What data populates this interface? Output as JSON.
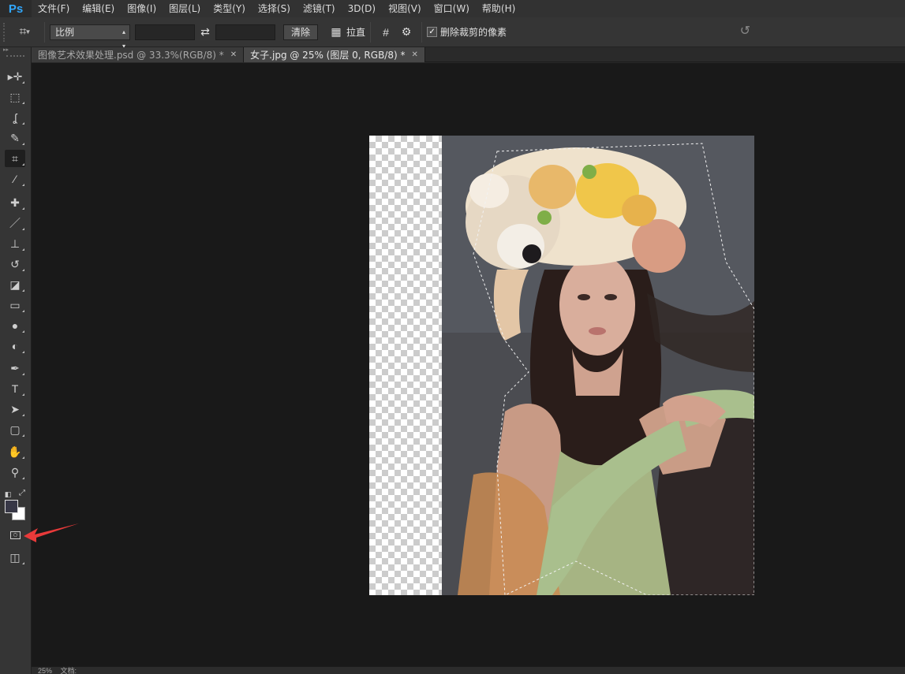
{
  "app": {
    "logo": "Ps",
    "menu": [
      "文件(F)",
      "编辑(E)",
      "图像(I)",
      "图层(L)",
      "类型(Y)",
      "选择(S)",
      "滤镜(T)",
      "3D(D)",
      "视图(V)",
      "窗口(W)",
      "帮助(H)"
    ]
  },
  "options": {
    "ratio_select": "比例",
    "clear_button": "清除",
    "straighten_label": "拉直",
    "delete_cropped_label": "删除裁剪的像素",
    "delete_cropped_checked": true
  },
  "tabs": [
    {
      "label": "图像艺术效果处理.psd @ 33.3%(RGB/8) *",
      "active": false
    },
    {
      "label": "女子.jpg @ 25% (图层 0, RGB/8) *",
      "active": true
    }
  ],
  "tools": [
    {
      "name": "move-tool",
      "glyph": "▸✛"
    },
    {
      "name": "marquee-tool",
      "glyph": "⬚"
    },
    {
      "name": "lasso-tool",
      "glyph": "ʆ"
    },
    {
      "name": "quick-select-tool",
      "glyph": "✎"
    },
    {
      "name": "crop-tool",
      "glyph": "⌗"
    },
    {
      "name": "eyedropper-tool",
      "glyph": "⁄"
    },
    {
      "name": "healing-tool",
      "glyph": "✚"
    },
    {
      "name": "brush-tool",
      "glyph": "／"
    },
    {
      "name": "stamp-tool",
      "glyph": "⊥"
    },
    {
      "name": "history-brush-tool",
      "glyph": "↺"
    },
    {
      "name": "eraser-tool",
      "glyph": "◪"
    },
    {
      "name": "gradient-tool",
      "glyph": "▭"
    },
    {
      "name": "blur-tool",
      "glyph": "●"
    },
    {
      "name": "dodge-tool",
      "glyph": "◐"
    },
    {
      "name": "pen-tool",
      "glyph": "✒"
    },
    {
      "name": "type-tool",
      "glyph": "T"
    },
    {
      "name": "path-select-tool",
      "glyph": "➤"
    },
    {
      "name": "shape-tool",
      "glyph": "▢"
    },
    {
      "name": "hand-tool",
      "glyph": "✋"
    },
    {
      "name": "zoom-tool",
      "glyph": "⚲"
    }
  ],
  "colors": {
    "foreground": "#383847",
    "background": "#ffffff",
    "annotation_arrow": "#e83a3a"
  },
  "status": {
    "zoom": "25%",
    "doc_label": "文档:"
  }
}
